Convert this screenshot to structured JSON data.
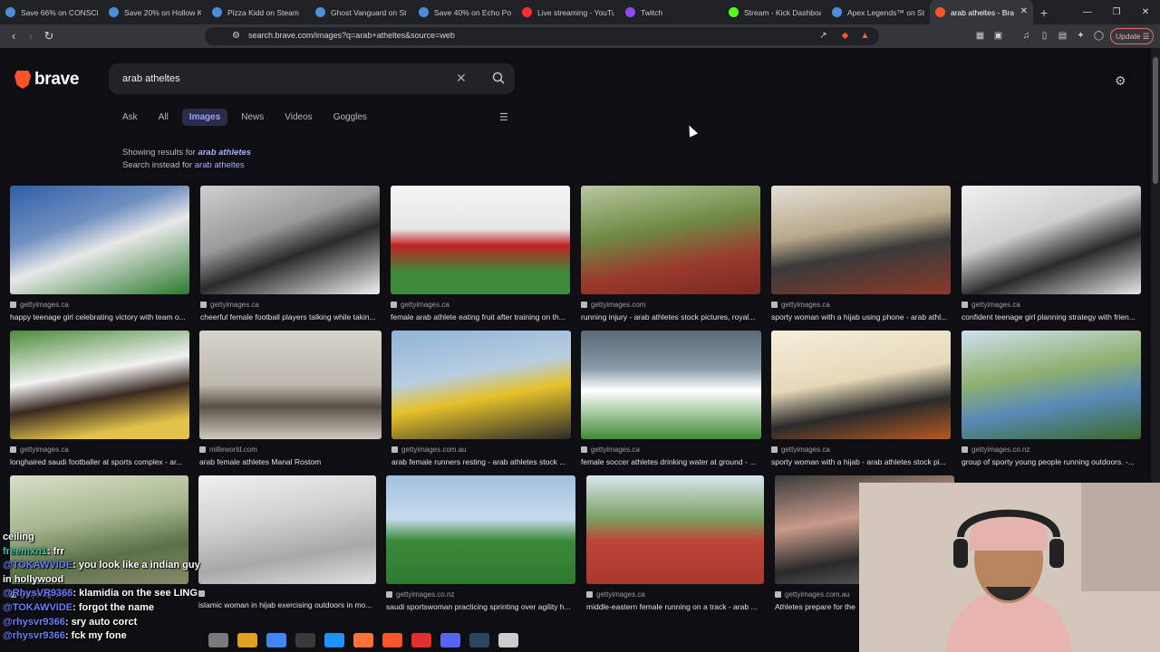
{
  "tabs": [
    {
      "title": "Save 66% on CONSCRI",
      "color": "#4a90d9"
    },
    {
      "title": "Save 20% on Hollow K",
      "color": "#4a90d9"
    },
    {
      "title": "Pizza Kidd on Steam",
      "color": "#4a90d9"
    },
    {
      "title": "Ghost Vanguard on St",
      "color": "#4a90d9"
    },
    {
      "title": "Save 40% on Echo Poi",
      "color": "#4a90d9"
    },
    {
      "title": "Live streaming - YouTu",
      "color": "#ff2d2d"
    },
    {
      "title": "Twitch",
      "color": "#9146ff"
    },
    {
      "title": "Stream - Kick Dashboa",
      "color": "#53fc18"
    },
    {
      "title": "Apex Legends™ on Ste",
      "color": "#4a90d9"
    },
    {
      "title": "arab atheltes - Bra",
      "color": "#fb542b",
      "active": true
    }
  ],
  "url": "search.brave.com/images?q=arab+atheltes&source=web",
  "update_label": "Update",
  "logo_text": "brave",
  "search": {
    "query": "arab atheltes"
  },
  "nav_tabs": [
    {
      "label": "Ask"
    },
    {
      "label": "All"
    },
    {
      "label": "Images",
      "active": true
    },
    {
      "label": "News"
    },
    {
      "label": "Videos"
    },
    {
      "label": "Goggles"
    }
  ],
  "correction": {
    "prefix": "Showing results for",
    "corrected": "arab athletes",
    "instead_prefix": "Search instead for",
    "original": "arab atheltes"
  },
  "images": [
    {
      "source": "gettyimages.ca",
      "caption": "happy teenage girl celebrating victory with team o...",
      "bg": "linear-gradient(160deg,#2f5fa8 0%,#6f8fbf 35%,#e8e8e8 55%,#2d7a2f 100%)"
    },
    {
      "source": "gettyimages.ca",
      "caption": "cheerful female football players talking while takin...",
      "bg": "linear-gradient(160deg,#cfcfcf 0%,#9a9a9a 40%,#2a2a2a 60%,#f2f2f2 100%)"
    },
    {
      "source": "gettyimages.ca",
      "caption": "female arab athlete eating fruit after training on th...",
      "bg": "linear-gradient(180deg,#f5f5f5 0%,#e6e6e6 40%,#c02222 55%,#3d8a3d 80%)"
    },
    {
      "source": "gettyimages.com",
      "caption": "running injury - arab athletes stock pictures, royal...",
      "bg": "linear-gradient(170deg,#b9c7a0 0%,#6f8a44 40%,#9a3a2c 70%,#7a2a22 100%)"
    },
    {
      "source": "gettyimages.ca",
      "caption": "sporty woman with a hijab using phone - arab athl...",
      "bg": "linear-gradient(170deg,#e4e0d6 0%,#b8a88a 40%,#3a3a3a 60%,#8a3a2a 100%)"
    },
    {
      "source": "gettyimages.ca",
      "caption": "confident teenage girl planning strategy with frien...",
      "bg": "linear-gradient(160deg,#f0f0f0 0%,#cfcfcf 40%,#2a2a2a 65%,#e8e8e8 100%)"
    },
    {
      "source": "gettyimages.ca",
      "caption": "longhaired saudi footballer at sports complex - ar...",
      "bg": "linear-gradient(170deg,#4b8a3a 0%,#f2f2f2 40%,#3a2a22 60%,#e2c24a 85%)"
    },
    {
      "source": "milleworld.com",
      "caption": "arab female athletes Manal Rostom",
      "bg": "linear-gradient(180deg,#d8d4cc 0%,#bdb8ae 50%,#5a5048 70%,#cfc9bf 100%)"
    },
    {
      "source": "gettyimages.com.au",
      "caption": "arab female runners resting - arab athletes stock ...",
      "bg": "linear-gradient(170deg,#8fb4d8 0%,#b8cde0 40%,#e5c12a 60%,#2a2a2a 100%)"
    },
    {
      "source": "gettyimages.ca",
      "caption": "female soccer athletes drinking water at ground - ...",
      "bg": "linear-gradient(180deg,#5a6a7a 0%,#8a9aa8 35%,#ffffff 55%,#3f8a35 100%)"
    },
    {
      "source": "gettyimages.ca",
      "caption": "sporty woman with a hijab - arab athletes stock pi...",
      "bg": "linear-gradient(170deg,#f5eedc 0%,#e6d8b8 45%,#2a2a2a 70%,#b85a22 100%)"
    },
    {
      "source": "gettyimages.co.nz",
      "caption": "group of sporty young people running outdoors. -...",
      "bg": "linear-gradient(170deg,#cfe0ef 0%,#8fb070 40%,#5a8ab8 65%,#3a6a2a 100%)"
    },
    {
      "source": "gettyimages.ca",
      "caption": "",
      "bg": "linear-gradient(170deg,#d8e0c8 0%,#a8b890 40%,#5a7048 70%,#8a8a6a 100%)"
    },
    {
      "source": "",
      "caption": "islamic woman in hijab exercising outdoors in mo...",
      "bg": "linear-gradient(170deg,#f0f0f0 0%,#d0d0d0 40%,#a8a8a8 70%,#e0e0e0 100%)"
    },
    {
      "source": "gettyimages.co.nz",
      "caption": "saudi sportswoman practicing sprinting over agility h...",
      "bg": "linear-gradient(180deg,#9fc0dd 0%,#c8dcec 40%,#3a8a3a 60%,#2f7a2f 100%)"
    },
    {
      "source": "gettyimages.ca",
      "caption": "middle-eastern female running on a track - arab ...",
      "bg": "linear-gradient(180deg,#d8e6f0 0%,#7aa060 40%,#c0443a 60%,#a8382f 100%)"
    },
    {
      "source": "gettyimages.com.au",
      "caption": "Athletes prepare for the",
      "bg": "linear-gradient(170deg,#3a3a3a 0%,#c89a8a 40%,#2a2a2a 70%,#6a6a6a 100%)"
    }
  ],
  "chat": [
    {
      "user": "",
      "text": "ceiling"
    },
    {
      "user": "freemxn1",
      "text": ": frr"
    },
    {
      "user": "@TOKAWVIDE",
      "text": ": you look like a indian guy"
    },
    {
      "user": "",
      "text": "in hollywood"
    },
    {
      "user": "@RhysVR9366",
      "text": ": klamidia on the see LING"
    },
    {
      "user": "@TOKAWVIDE",
      "text": ": forgot the name"
    },
    {
      "user": "@rhysvr9366",
      "text": ": sry auto corct"
    },
    {
      "user": "@rhysvr9366",
      "text": ": fck my fone"
    }
  ],
  "taskbar_icons": [
    "#7a7a7a",
    "#e0a020",
    "#4285f4",
    "#3a3a3a",
    "#1e90ff",
    "#ff7139",
    "#fb542b",
    "#e03030",
    "#5865f2",
    "#2a475e",
    "#cccccc"
  ]
}
